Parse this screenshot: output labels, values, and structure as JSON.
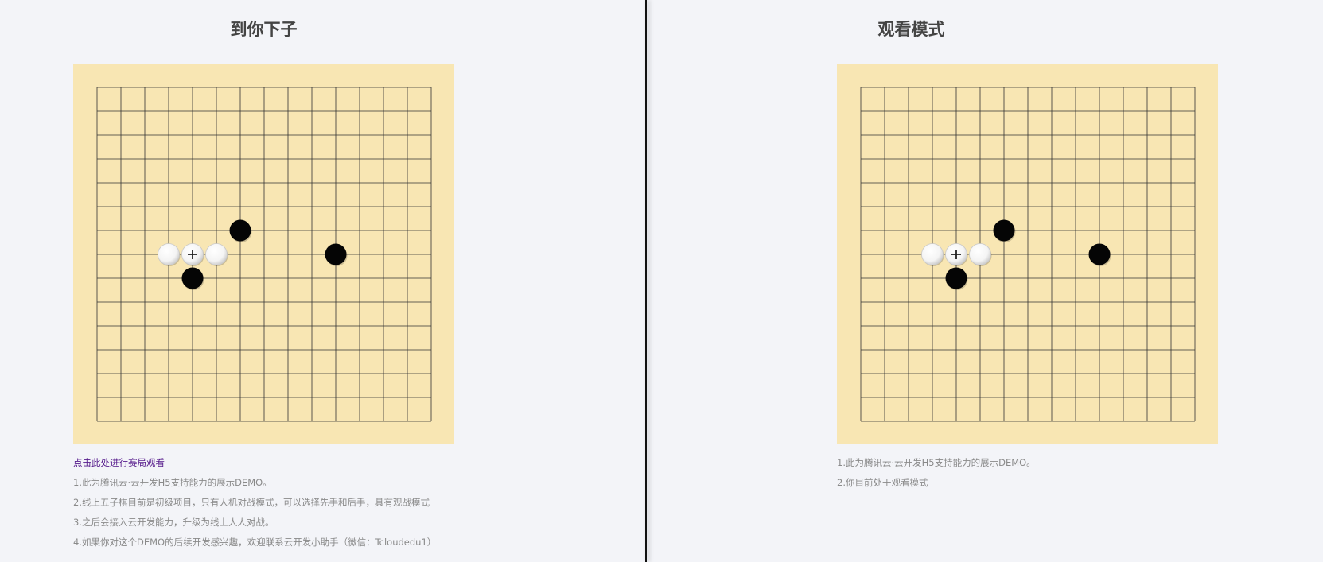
{
  "left": {
    "title": "到你下子",
    "watch_link": "点击此处进行赛局观看",
    "notes": [
      "1.此为腾讯云·云开发H5支持能力的展示DEMO。",
      "2.线上五子棋目前是初级项目，只有人机对战模式，可以选择先手和后手，具有观战模式",
      "3.之后会接入云开发能力，升级为线上人人对战。",
      "4.如果你对这个DEMO的后续开发感兴趣，欢迎联系云开发小助手（微信：Tcloudedu1）"
    ]
  },
  "right": {
    "title": "观看模式",
    "notes": [
      "1.此为腾讯云·云开发H5支持能力的展示DEMO。",
      "2.你目前处于观看模式"
    ]
  },
  "board": {
    "size": 15,
    "stones": [
      {
        "col": 6,
        "row": 6,
        "color": "black"
      },
      {
        "col": 3,
        "row": 7,
        "color": "white"
      },
      {
        "col": 4,
        "row": 7,
        "color": "white",
        "last_move": true
      },
      {
        "col": 5,
        "row": 7,
        "color": "white"
      },
      {
        "col": 10,
        "row": 7,
        "color": "black"
      },
      {
        "col": 4,
        "row": 8,
        "color": "black"
      }
    ]
  },
  "colors": {
    "board_bg": "#f8e6b3",
    "grid": "#333333",
    "page_bg": "#f3f4f8"
  }
}
